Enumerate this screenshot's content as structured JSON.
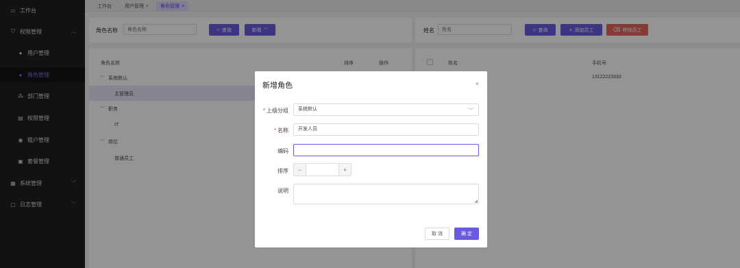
{
  "sidebar": {
    "items": [
      {
        "label": "工作台",
        "icon": "monitor-icon"
      },
      {
        "label": "权限管理",
        "icon": "shield-icon"
      },
      {
        "label": "用户管理",
        "icon": "user-icon"
      },
      {
        "label": "角色管理",
        "icon": "role-icon"
      },
      {
        "label": "部门管理",
        "icon": "org-icon"
      },
      {
        "label": "权限管理",
        "icon": "permission-icon"
      },
      {
        "label": "租户管理",
        "icon": "tenant-icon"
      },
      {
        "label": "套餐管理",
        "icon": "package-icon"
      },
      {
        "label": "系统管理",
        "icon": "windows-icon"
      },
      {
        "label": "日志管理",
        "icon": "log-icon"
      }
    ]
  },
  "tabs": [
    {
      "label": "工作台"
    },
    {
      "label": "用户管理"
    },
    {
      "label": "角色管理"
    }
  ],
  "left_panel": {
    "search_label": "角色名称",
    "search_placeholder": "角色名称",
    "query_label": "查询",
    "add_label": "新增",
    "columns": [
      "角色名称",
      "排序",
      "操作"
    ],
    "tree": [
      {
        "label": "系统默认"
      },
      {
        "label": "主管理员"
      },
      {
        "label": "职务"
      },
      {
        "label": "IT"
      },
      {
        "label": "岗位"
      },
      {
        "label": "普通员工"
      }
    ]
  },
  "right_panel": {
    "search_label": "姓名",
    "search_placeholder": "姓名",
    "query_label": "查询",
    "add_member_label": "添加员工",
    "remove_member_label": "移除员工",
    "columns": [
      "姓名",
      "手机号"
    ],
    "rows": [
      {
        "name": "",
        "phone": "13122223333"
      }
    ]
  },
  "modal": {
    "title": "新增角色",
    "close": "×",
    "fields": {
      "parent_group_label": "上级分组",
      "parent_group_value": "系统默认",
      "name_label": "名称",
      "name_value": "开发人员",
      "code_label": "编码",
      "code_value": "",
      "sort_label": "排序",
      "sort_value": "",
      "desc_label": "说明"
    },
    "cancel_label": "取 消",
    "ok_label": "确 定"
  },
  "colors": {
    "accent": "#6a5ae0",
    "danger": "#e9625c",
    "sidebar_bg": "#1f1f1f"
  }
}
